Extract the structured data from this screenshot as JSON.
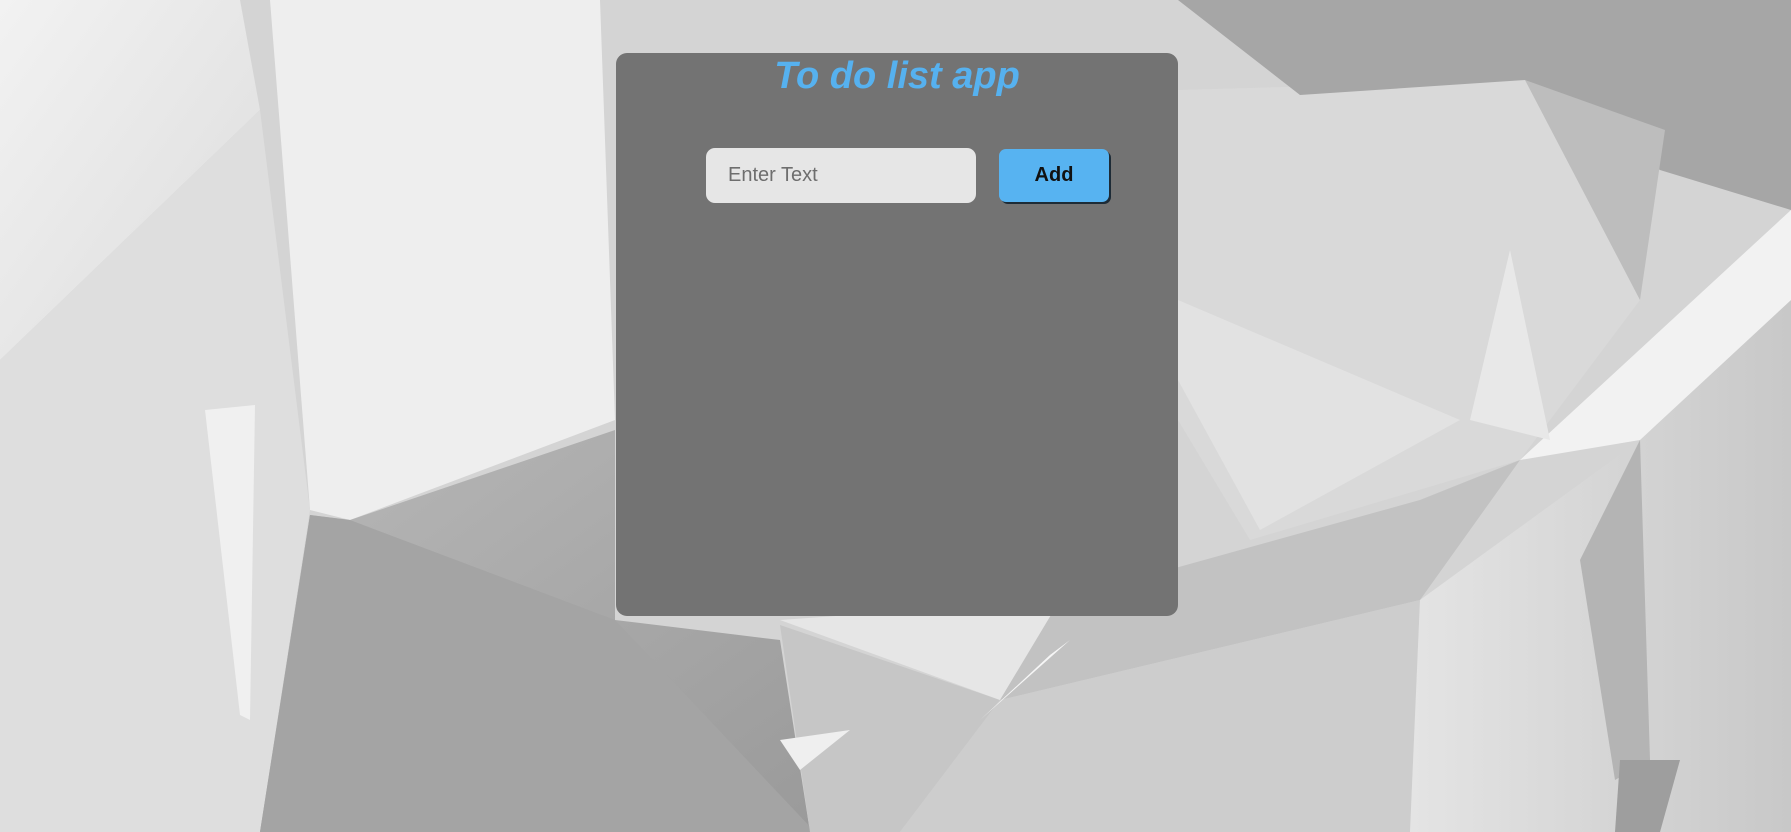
{
  "app": {
    "title": "To do list app"
  },
  "input": {
    "placeholder": "Enter Text",
    "value": ""
  },
  "add_button": {
    "label": "Add"
  },
  "todos": [],
  "colors": {
    "card_background": "#737373",
    "title": "#56b1ef",
    "button": "#57b3f1",
    "input_background": "#e6e6e6",
    "page_background": "#d6d6d6"
  }
}
